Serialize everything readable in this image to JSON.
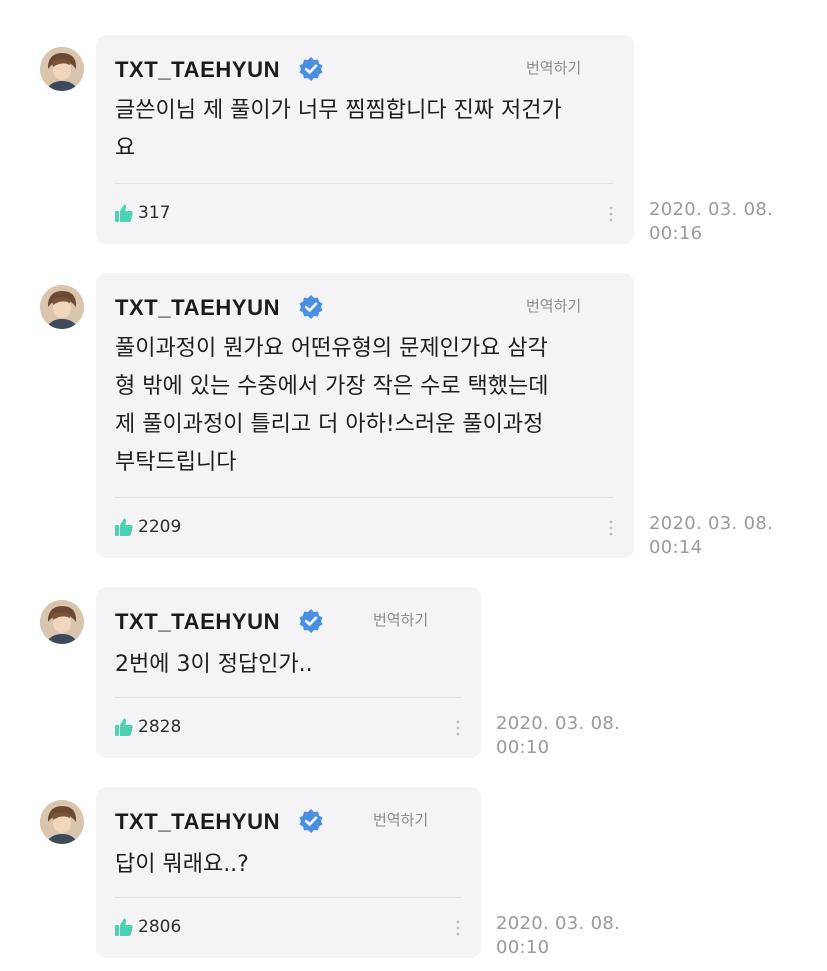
{
  "comments": [
    {
      "author": "TXT_TAEHYUN",
      "translate_label": "번역하기",
      "lines": [
        "글쓴이님 제 풀이가 너무 찜찜합니다 진짜 저건가",
        "요"
      ],
      "likes": "317",
      "date": "2020. 03. 08.",
      "time": "00:16"
    },
    {
      "author": "TXT_TAEHYUN",
      "translate_label": "번역하기",
      "lines": [
        "풀이과정이 뭔가요 어떤유형의 문제인가요 삼각",
        "형 밖에 있는 수중에서 가장 작은 수로 택했는데",
        "제 풀이과정이 틀리고 더 아하!스러운 풀이과정",
        "부탁드립니다"
      ],
      "likes": "2209",
      "date": "2020. 03. 08.",
      "time": "00:14"
    },
    {
      "author": "TXT_TAEHYUN",
      "translate_label": "번역하기",
      "lines": [
        "2번에 3이 정답인가.."
      ],
      "likes": "2828",
      "date": "2020. 03. 08.",
      "time": "00:10"
    },
    {
      "author": "TXT_TAEHYUN",
      "translate_label": "번역하기",
      "lines": [
        "답이 뭐래요..?"
      ],
      "likes": "2806",
      "date": "2020. 03. 08.",
      "time": "00:10"
    }
  ],
  "icons": {
    "verified": "verified-badge-icon",
    "like": "thumbs-up-icon",
    "more": "more-vertical-icon"
  },
  "colors": {
    "bubble_background": "#f4f4f6",
    "verified_badge": "#4a90e2",
    "like_icon": "#4fd1b4",
    "timestamp": "#9a9a9a",
    "translate": "#8c8c8c"
  }
}
